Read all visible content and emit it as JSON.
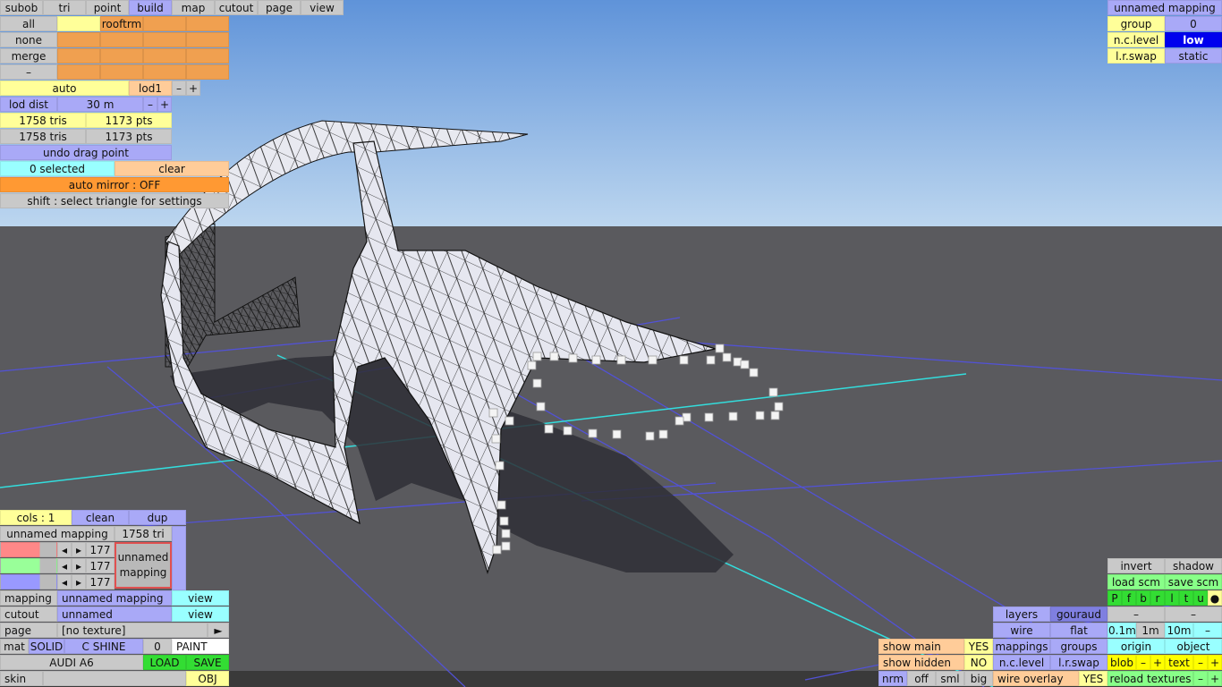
{
  "top_tabs": [
    "subob",
    "tri",
    "point",
    "build",
    "map",
    "cutout",
    "page",
    "view"
  ],
  "active_tab": "build",
  "select_rows": [
    "all",
    "none",
    "merge",
    "–"
  ],
  "grid_label": "rooftrm",
  "lod": {
    "auto": "auto",
    "level": "lod1",
    "minus": "–",
    "plus": "+"
  },
  "lod_dist": {
    "label": "lod dist",
    "value": "30 m",
    "minus": "–",
    "plus": "+"
  },
  "counts": {
    "tris1": "1758 tris",
    "pts1": "1173 pts",
    "tris2": "1758 tris",
    "pts2": "1173 pts"
  },
  "undo": "undo drag point",
  "selection": {
    "count": "0 selected",
    "clear": "clear"
  },
  "auto_mirror": "auto mirror : OFF",
  "shift_hint": "shift : select triangle for settings",
  "top_right": {
    "mapping": "unnamed mapping",
    "group_label": "group",
    "group_value": "0",
    "nc_label": "n.c.level",
    "nc_value": "low",
    "lr_label": "l.r.swap",
    "lr_value": "static"
  },
  "bottom_left": {
    "cols": "cols : 1",
    "clean": "clean",
    "dup": "dup",
    "mapping_name": "unnamed mapping",
    "tri_count": "1758 tri",
    "color_values": [
      "177",
      "177",
      "177"
    ],
    "preview_label": "unnamed mapping",
    "mapping_label": "mapping",
    "mapping_value": "unnamed mapping",
    "view1": "view",
    "cutout_label": "cutout",
    "cutout_value": "unnamed",
    "view2": "view",
    "page_label": "page",
    "page_value": "[no texture]",
    "page_arrow": "►",
    "mat": "mat",
    "solid": "SOLID",
    "cshine": "C SHINE",
    "shine_val": "0",
    "paint": "PAINT",
    "model_name": "AUDI A6",
    "load": "LOAD",
    "save": "SAVE",
    "skin": "skin",
    "obj": "OBJ"
  },
  "bottom_right": {
    "invert": "invert",
    "shadow": "shadow",
    "load_scm": "load scm",
    "save_scm": "save scm",
    "letters": [
      "P",
      "f",
      "b",
      "r",
      "l",
      "t",
      "u",
      "●"
    ],
    "dash1": "–",
    "dash2": "–",
    "layers": "layers",
    "gouraud": "gouraud",
    "wire": "wire",
    "flat": "flat",
    "d01": "0.1m",
    "d1": "1m",
    "d10": "10m",
    "dminus": "–",
    "show_main": "show main",
    "show_main_v": "YES",
    "mappings": "mappings",
    "groups": "groups",
    "origin": "origin",
    "object": "object",
    "show_hidden": "show hidden",
    "show_hidden_v": "NO",
    "nclevel": "n.c.level",
    "lrswap": "l.r.swap",
    "blob": "blob",
    "text": "text",
    "pm": [
      "–",
      "+",
      "–",
      "+"
    ],
    "nrm": "nrm",
    "off": "off",
    "sml": "sml",
    "big": "big",
    "wire_overlay": "wire overlay",
    "wire_overlay_v": "YES",
    "reload": "reload textures",
    "reload_minus": "–",
    "reload_plus": "+"
  }
}
